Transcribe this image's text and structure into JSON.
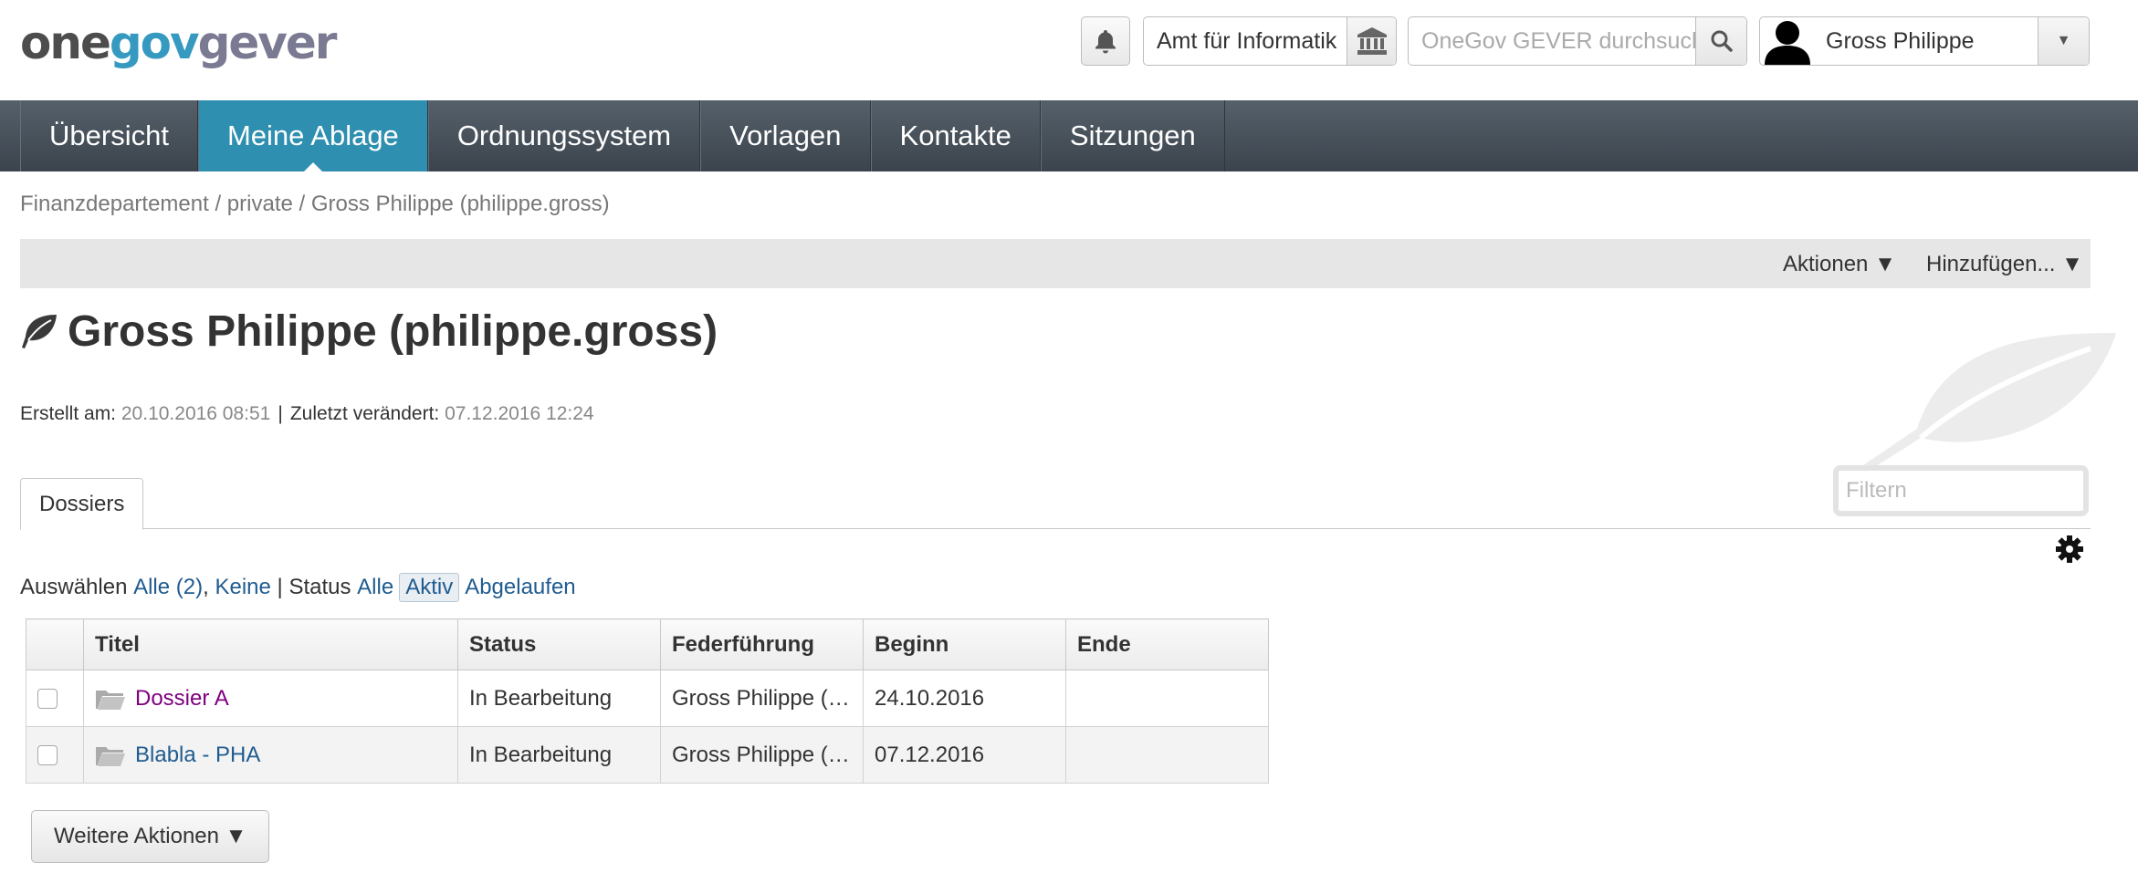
{
  "logo": {
    "part1": "one",
    "part2": "gov",
    "part3": "gever"
  },
  "header": {
    "org_label": "Amt für Informatik",
    "search_placeholder": "OneGov GEVER durchsuchen",
    "user_name": "Gross Philippe"
  },
  "nav": {
    "items": [
      {
        "label": "Übersicht"
      },
      {
        "label": "Meine Ablage"
      },
      {
        "label": "Ordnungssystem"
      },
      {
        "label": "Vorlagen"
      },
      {
        "label": "Kontakte"
      },
      {
        "label": "Sitzungen"
      }
    ],
    "active_index": 1
  },
  "breadcrumb": "Finanzdepartement / private / Gross Philippe (philippe.gross)",
  "actionbar": {
    "actions": "Aktionen ▼",
    "add": "Hinzufügen... ▼"
  },
  "page_title": "Gross Philippe (philippe.gross)",
  "meta": {
    "created_label": "Erstellt am:",
    "created_value": "20.10.2016 08:51",
    "modified_label": "Zuletzt verändert:",
    "modified_value": "07.12.2016 12:24"
  },
  "tabs": [
    {
      "label": "Dossiers"
    }
  ],
  "filter_placeholder": "Filtern",
  "selection": {
    "select_label": "Auswählen",
    "all": "Alle (2)",
    "comma": ",",
    "none": "Keine",
    "divider": "|",
    "status_label": "Status",
    "status_all": "Alle",
    "status_active": "Aktiv",
    "status_expired": "Abgelaufen"
  },
  "table": {
    "columns": [
      "",
      "Titel",
      "Status",
      "Federführung",
      "Beginn",
      "Ende"
    ],
    "rows": [
      {
        "title": "Dossier A",
        "status": "In Bearbeitung",
        "lead": "Gross Philippe (…",
        "start": "24.10.2016",
        "end": "",
        "title_color": "#800080"
      },
      {
        "title": "Blabla - PHA",
        "status": "In Bearbeitung",
        "lead": "Gross Philippe (…",
        "start": "07.12.2016",
        "end": "",
        "title_color": "#205c90"
      }
    ]
  },
  "more_actions": "Weitere Aktionen ▼"
}
